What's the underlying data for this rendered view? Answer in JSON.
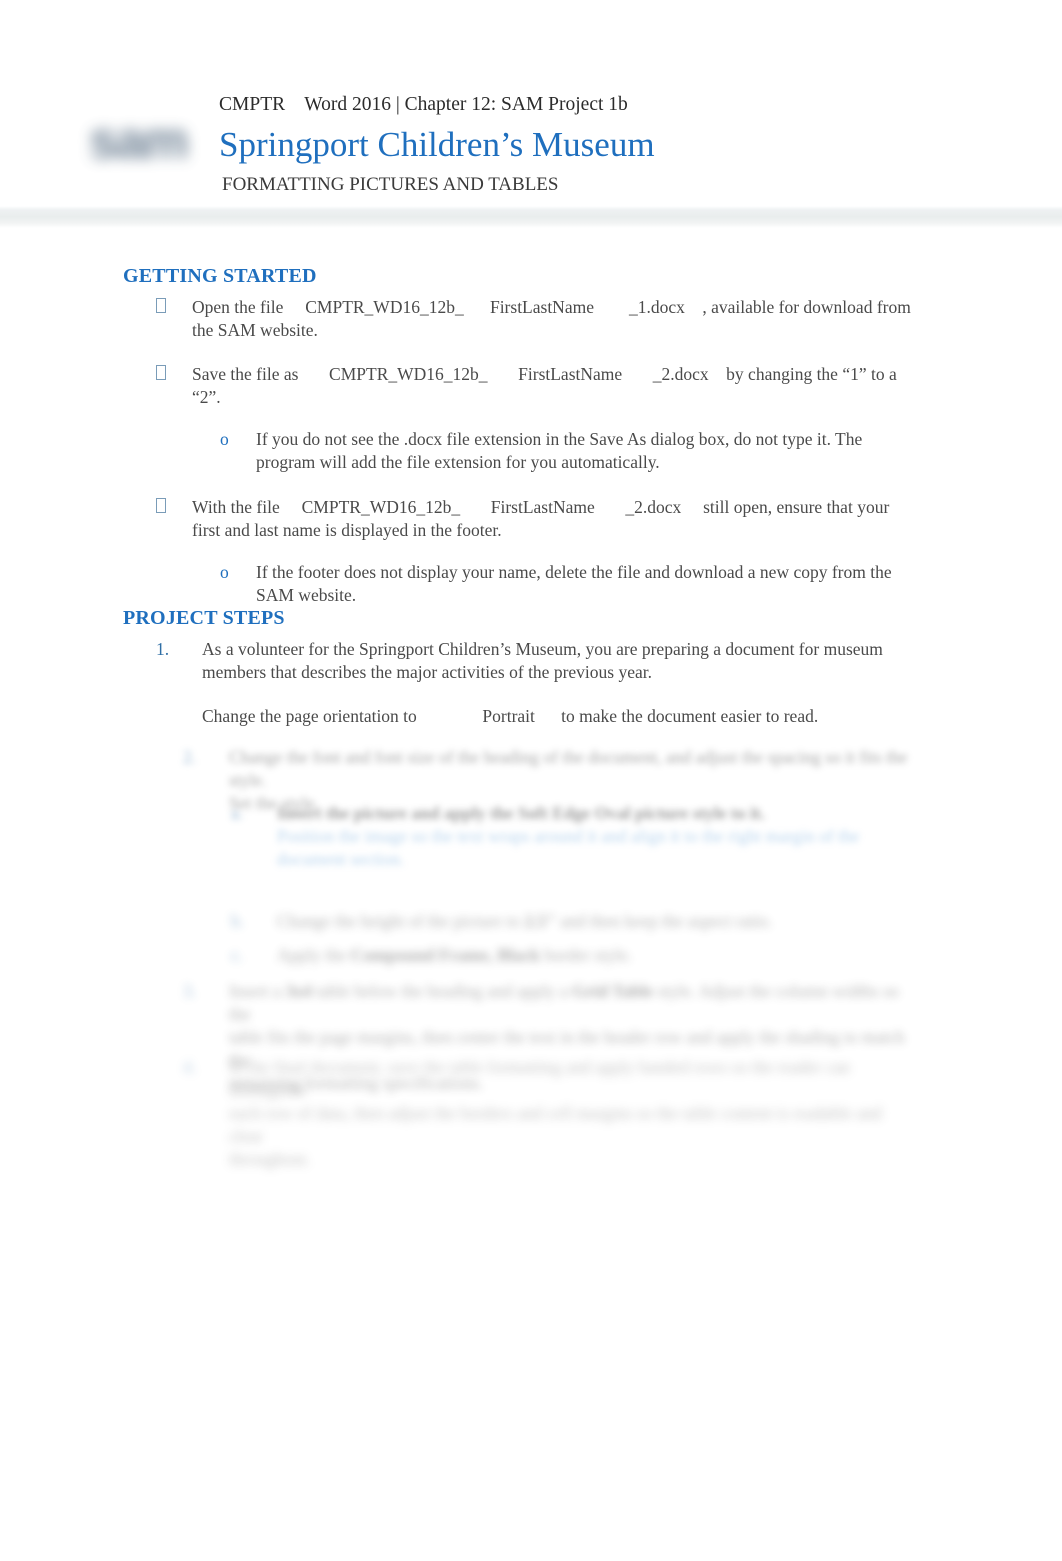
{
  "header": {
    "logo_text": "sam",
    "course_line": "CMPTR    Word 2016 | Chapter 12: SAM Project 1b",
    "title": "Springport Children’s Museum",
    "subtitle": "FORMATTING PICTURES AND TABLES"
  },
  "colors": {
    "accent_blue": "#1f6fbe",
    "body_text": "#4a4a4a",
    "bullet_blue": "#7a9cb8",
    "rule_gray": "#e9eded"
  },
  "getting_started": {
    "heading": "GETTING STARTED",
    "items": [
      {
        "marker": "tofu-bullet",
        "text": "Open the file     CMPTR_WD16_12b_      FirstLastName        _1.docx    , available for download from the SAM website."
      },
      {
        "marker": "tofu-bullet",
        "text": "Save the file as       CMPTR_WD16_12b_       FirstLastName       _2.docx    by changing the “1” to a “2”."
      },
      {
        "marker": "o",
        "text": "If you do not see the .docx file extension in the Save As dialog box, do not type it. The program will add the file extension for you automatically."
      },
      {
        "marker": "tofu-bullet",
        "text": "With the file     CMPTR_WD16_12b_       FirstLastName       _2.docx     still open, ensure that your first and last name is displayed in the footer."
      },
      {
        "marker": "o",
        "text": "If the footer does not display your name, delete the file and download a new copy from the SAM website."
      }
    ]
  },
  "project_steps": {
    "heading": "PROJECT STEPS",
    "items": [
      {
        "marker": "1.",
        "text": "As a volunteer for the Springport Children’s Museum, you are preparing a document for museum members that describes the major activities of the previous year."
      },
      {
        "marker": "",
        "text": "Change the page orientation to               Portrait      to make the document easier to read."
      }
    ]
  },
  "obscured_region": {
    "note": "blurred-illegible-content",
    "items": [
      {
        "marker": "2.",
        "line_widths": [
          96,
          26
        ]
      },
      {
        "marker": "a.",
        "line_widths": [
          92,
          88,
          34
        ],
        "has_blue_run": true
      },
      {
        "marker": "b.",
        "line_widths": [
          91
        ]
      },
      {
        "marker": "c.",
        "line_widths": [
          68
        ]
      },
      {
        "marker": "3.",
        "line_widths": [
          97,
          99,
          40
        ]
      },
      {
        "marker": "4.",
        "line_widths": [
          98,
          95,
          18
        ]
      }
    ]
  }
}
